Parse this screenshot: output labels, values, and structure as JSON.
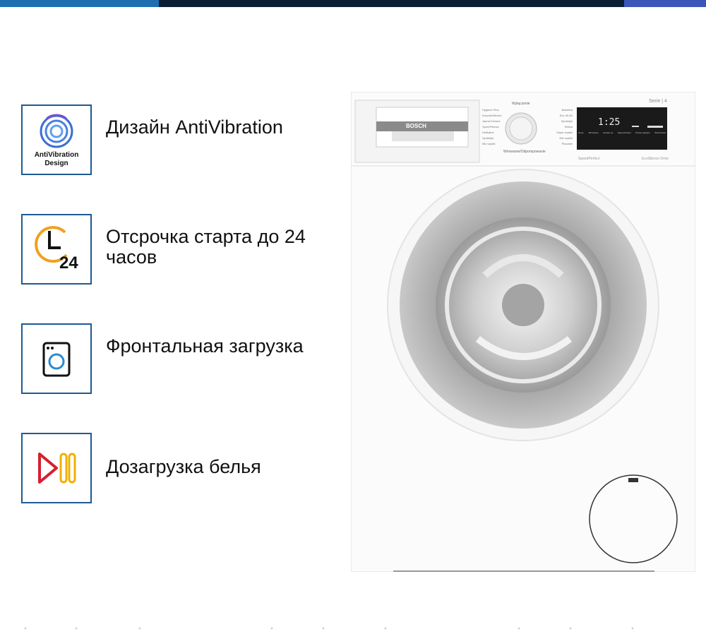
{
  "features": [
    {
      "icon": "antivibration-icon",
      "icon_text": "AntiVibration\nDesign",
      "label": "Дизайн AntiVibration"
    },
    {
      "icon": "delay-start-clock-icon",
      "icon_text": "24",
      "label": "Отсрочка старта до 24 часов"
    },
    {
      "icon": "front-loading-washer-icon",
      "label": "Фронтальная загрузка"
    },
    {
      "icon": "reload-pause-icon",
      "label": "Дозагрузка белья"
    }
  ],
  "washer": {
    "brand": "BOSCH",
    "series": "Serie | 4",
    "display_time": "1:25",
    "program_left": [
      "Hygiene Plus",
      "Koszule/Biznes",
      "Jasne/Ciemne",
      "Sport/Fitness",
      "Delikatne",
      "Syntetyki",
      "Mix szybki"
    ],
    "program_top": "Wyłączenie",
    "program_right": [
      "Bawełna",
      "Eco 40-60",
      "Syntetyki",
      "Wełna",
      "Super szybki",
      "Mix szybki",
      "Płukanie"
    ],
    "program_bottom": "Wirowanie/Odpompowanie",
    "panel_buttons": [
      "Temp.",
      "Wirowanie",
      "Gotowe za",
      "Speed Perfect",
      "Pranie wstępne",
      "Start Pauza"
    ],
    "footer_left": "SpeedPerfect",
    "footer_right": "EcoSilence Drive"
  },
  "colors": {
    "frame_blue": "#1d5a93",
    "clock_orange": "#f0a020",
    "play_red": "#d42030",
    "pause_yellow": "#f0b000",
    "av_blue": "#3a6fd0"
  }
}
